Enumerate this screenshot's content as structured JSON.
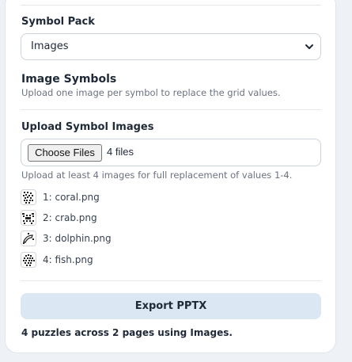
{
  "symbol_pack": {
    "label": "Symbol Pack",
    "selected": "Images"
  },
  "image_symbols": {
    "title": "Image Symbols",
    "description": "Upload one image per symbol to replace the grid values."
  },
  "upload": {
    "label": "Upload Symbol Images",
    "button_label": "Choose Files",
    "file_count": "4 files",
    "hint": "Upload at least 4 images for full replacement of values 1-4.",
    "files": [
      {
        "label": "1: coral.png",
        "icon": "coral-thumbnail-icon"
      },
      {
        "label": "2: crab.png",
        "icon": "crab-thumbnail-icon"
      },
      {
        "label": "3: dolphin.png",
        "icon": "dolphin-thumbnail-icon"
      },
      {
        "label": "4: fish.png",
        "icon": "fish-thumbnail-icon"
      }
    ]
  },
  "export": {
    "button_label": "Export PPTX"
  },
  "status": {
    "text": "4 puzzles across 2 pages using Images."
  },
  "colors": {
    "export_button_bg": "#dbe7f3",
    "muted_text": "#6b7280"
  }
}
